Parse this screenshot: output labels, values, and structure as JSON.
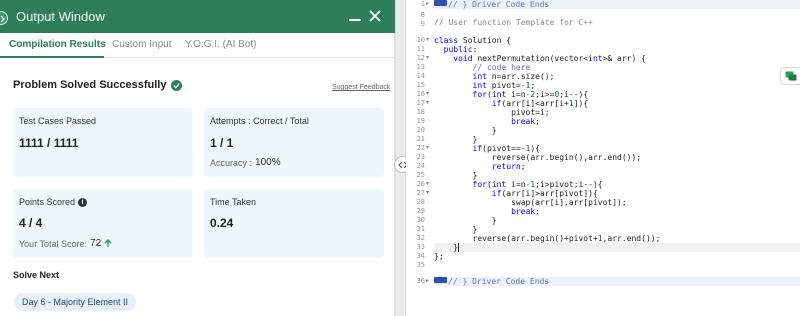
{
  "window": {
    "title": "Output Window"
  },
  "tabs": [
    {
      "label": "Compilation Results",
      "active": true
    },
    {
      "label": "Custom Input",
      "active": false
    },
    {
      "label": "Y.O.G.I. (AI Bot)",
      "active": false
    }
  ],
  "result": {
    "status": "Problem Solved Successfully",
    "feedback_link": "Suggest Feedback"
  },
  "cards": {
    "test_cases": {
      "title": "Test Cases Passed",
      "value": "1111 / 1111"
    },
    "attempts": {
      "title": "Attempts : Correct / Total",
      "value": "1 / 1",
      "accuracy_label": "Accuracy :",
      "accuracy_value": "100%"
    },
    "points": {
      "title": "Points Scored",
      "value": "4 / 4",
      "total_label": "Your Total Score:",
      "total_value": "72"
    },
    "time": {
      "title": "Time Taken",
      "value": "0.24"
    }
  },
  "solve_next": {
    "heading": "Solve Next",
    "item": "Day 6 - Majority Element II"
  },
  "colors": {
    "brand_green": "#2e7d5b",
    "card_bg": "#eef8fc",
    "keyword_blue": "#0000ff"
  },
  "editor": {
    "line_numbers": [
      "1",
      "8",
      "9",
      "10",
      "11",
      "12",
      "13",
      "14",
      "15",
      "16",
      "17",
      "18",
      "19",
      "20",
      "21",
      "22",
      "23",
      "24",
      "25",
      "26",
      "27",
      "28",
      "29",
      "30",
      "31",
      "32",
      "33",
      "34",
      "35",
      "36"
    ],
    "fold_markers": {
      "1": "▸",
      "10": "▾",
      "12": "▾",
      "16": "▾",
      "17": "▾",
      "22": "▾",
      "26": "▾",
      "27": "▾",
      "36": "▸"
    },
    "active_line": "33"
  },
  "icons": {
    "window_icon": "chevron-right-icon",
    "minimize": "minimize-icon",
    "close": "close-icon",
    "success": "check-circle-icon",
    "info": "info-icon",
    "up": "arrow-up-icon",
    "splitter": "resize-handle-icon",
    "chat": "chat-icon"
  }
}
